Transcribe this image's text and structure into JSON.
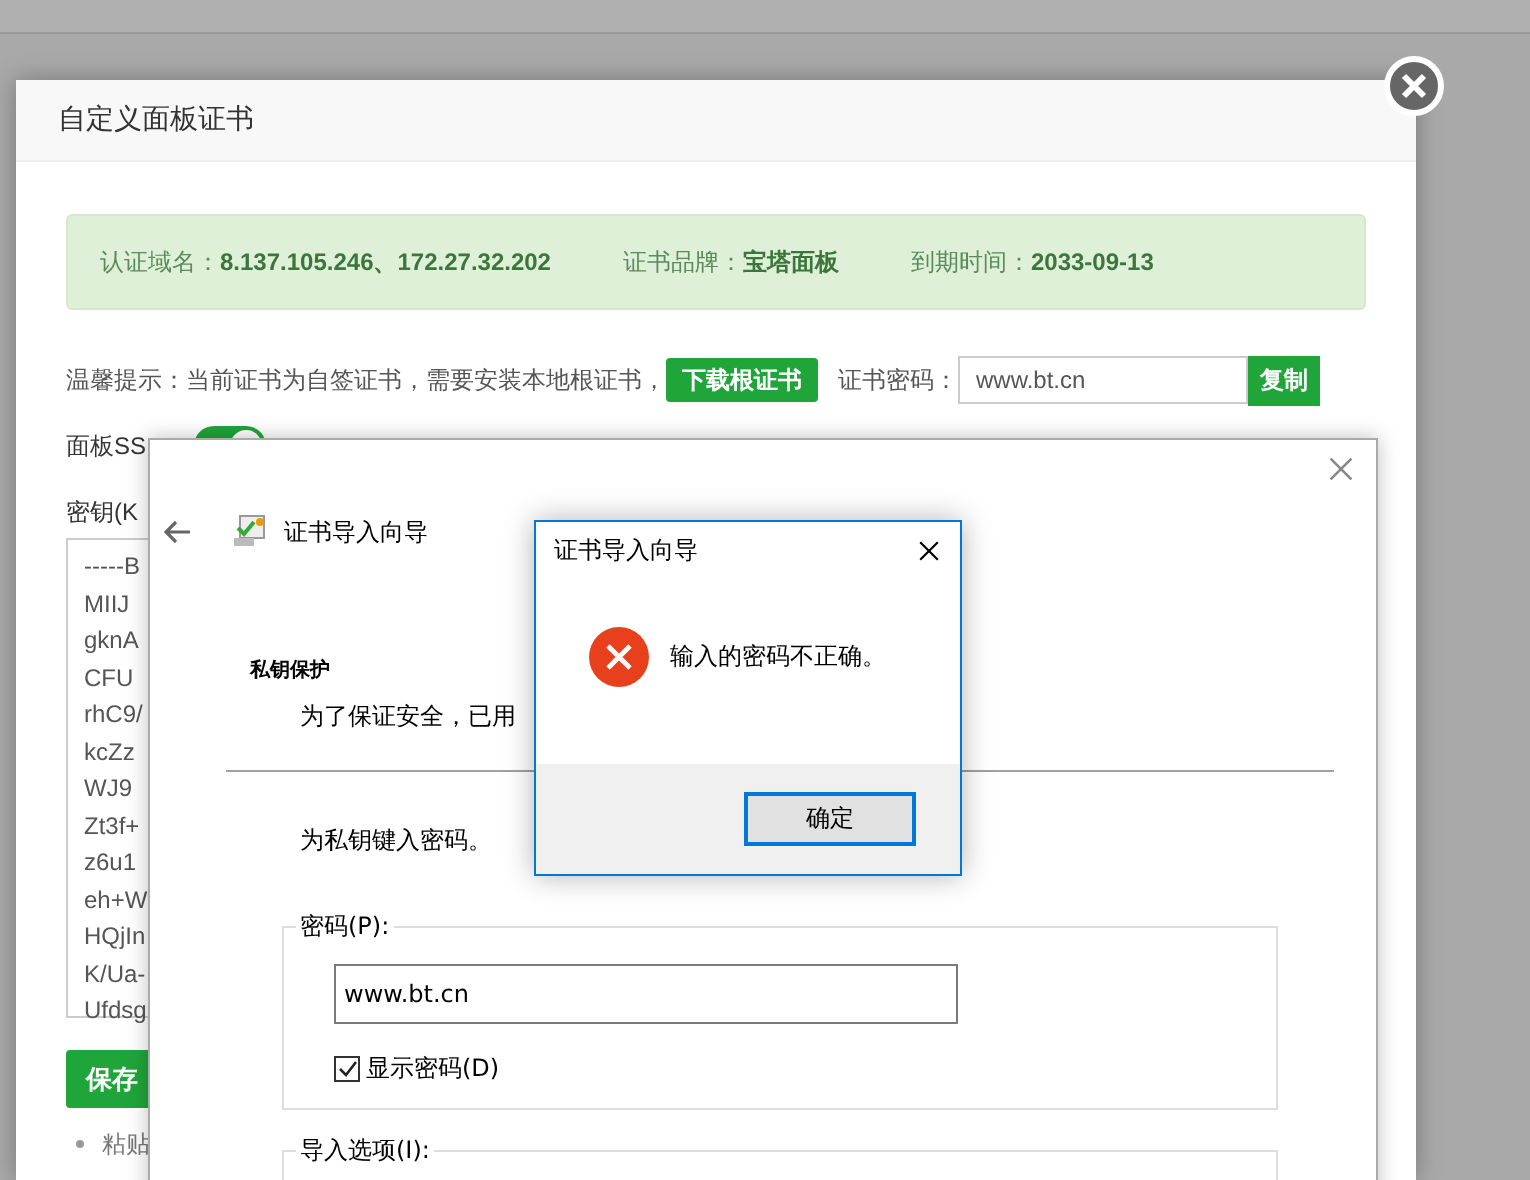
{
  "panel_dialog": {
    "title": "自定义面板证书"
  },
  "cert_info": [
    {
      "label": "认证域名：",
      "value": "8.137.105.246、172.27.32.202"
    },
    {
      "label": "证书品牌：",
      "value": "宝塔面板"
    },
    {
      "label": "到期时间：",
      "value": "2033-09-13"
    }
  ],
  "tip": {
    "text": "温馨提示：当前证书为自签证书，需要安装本地根证书，",
    "download_button": "下载根证书",
    "password_label": "证书密码：",
    "password_value": "www.bt.cn",
    "copy_button": "复制"
  },
  "ssl": {
    "label": "面板SS",
    "on": true
  },
  "key": {
    "label": "密钥(K",
    "lines": [
      "-----B",
      "MIIJ",
      "gknA",
      "CFU",
      "rhC9/",
      "kcZz",
      "WJ9",
      "Zt3f+",
      "z6u1",
      "eh+W",
      "HQjIn",
      "K/Ua-",
      "Ufdsg"
    ]
  },
  "save_button": "保存",
  "notes": [
    "粘贴"
  ],
  "import_wizard": {
    "title": "证书导入向导",
    "section_title": "私钥保护",
    "section_text": "为了保证安全，已用",
    "prompt": "为私钥键入密码。",
    "password_group": "密码(P):",
    "password_value": "www.bt.cn",
    "show_password": {
      "label": "显示密码(D)",
      "checked": true
    },
    "options_group": "导入选项(I):"
  },
  "error_dialog": {
    "title": "证书导入向导",
    "message": "输入的密码不正确。",
    "ok_button": "确定"
  }
}
